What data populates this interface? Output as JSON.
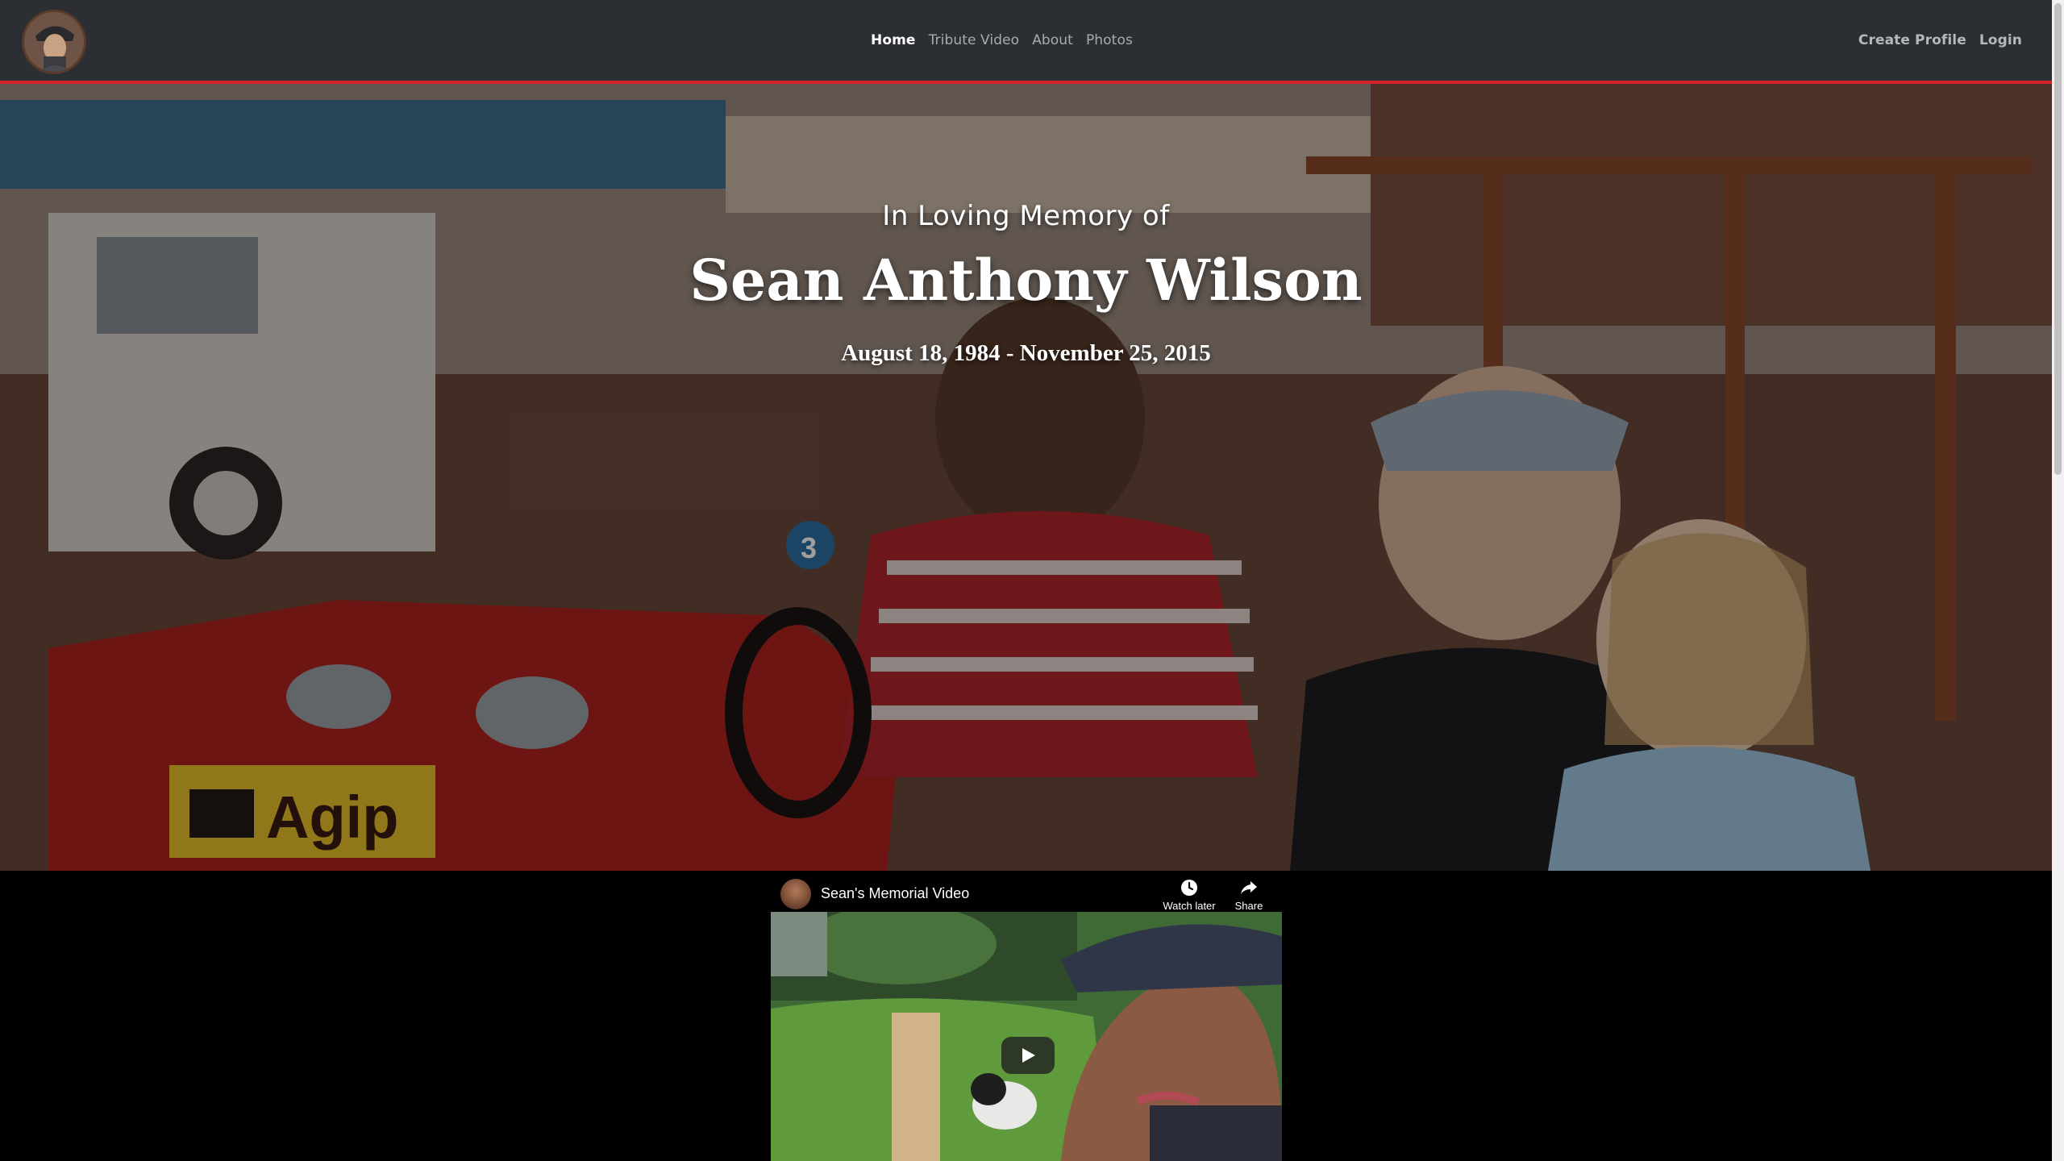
{
  "nav": {
    "center_links": [
      "Home",
      "Tribute Video",
      "About",
      "Photos"
    ],
    "right_links": [
      "Create Profile",
      "Login"
    ],
    "logo_icon": "profile-avatar"
  },
  "hero": {
    "pretitle": "In Loving Memory of",
    "name": "Sean Anthony Wilson",
    "dates": "August 18, 1984 - November 25, 2015",
    "photo_sign": "Agip",
    "photo_number": "3"
  },
  "video": {
    "title": "Sean's Memorial Video",
    "watch_later_label": "Watch later",
    "share_label": "Share",
    "icons": [
      "clock-icon",
      "share-icon",
      "play-icon"
    ]
  },
  "colors": {
    "navbar_bg": "#2b2e33",
    "accent_red": "#d4202a",
    "nav_text": "#a8abb0"
  }
}
